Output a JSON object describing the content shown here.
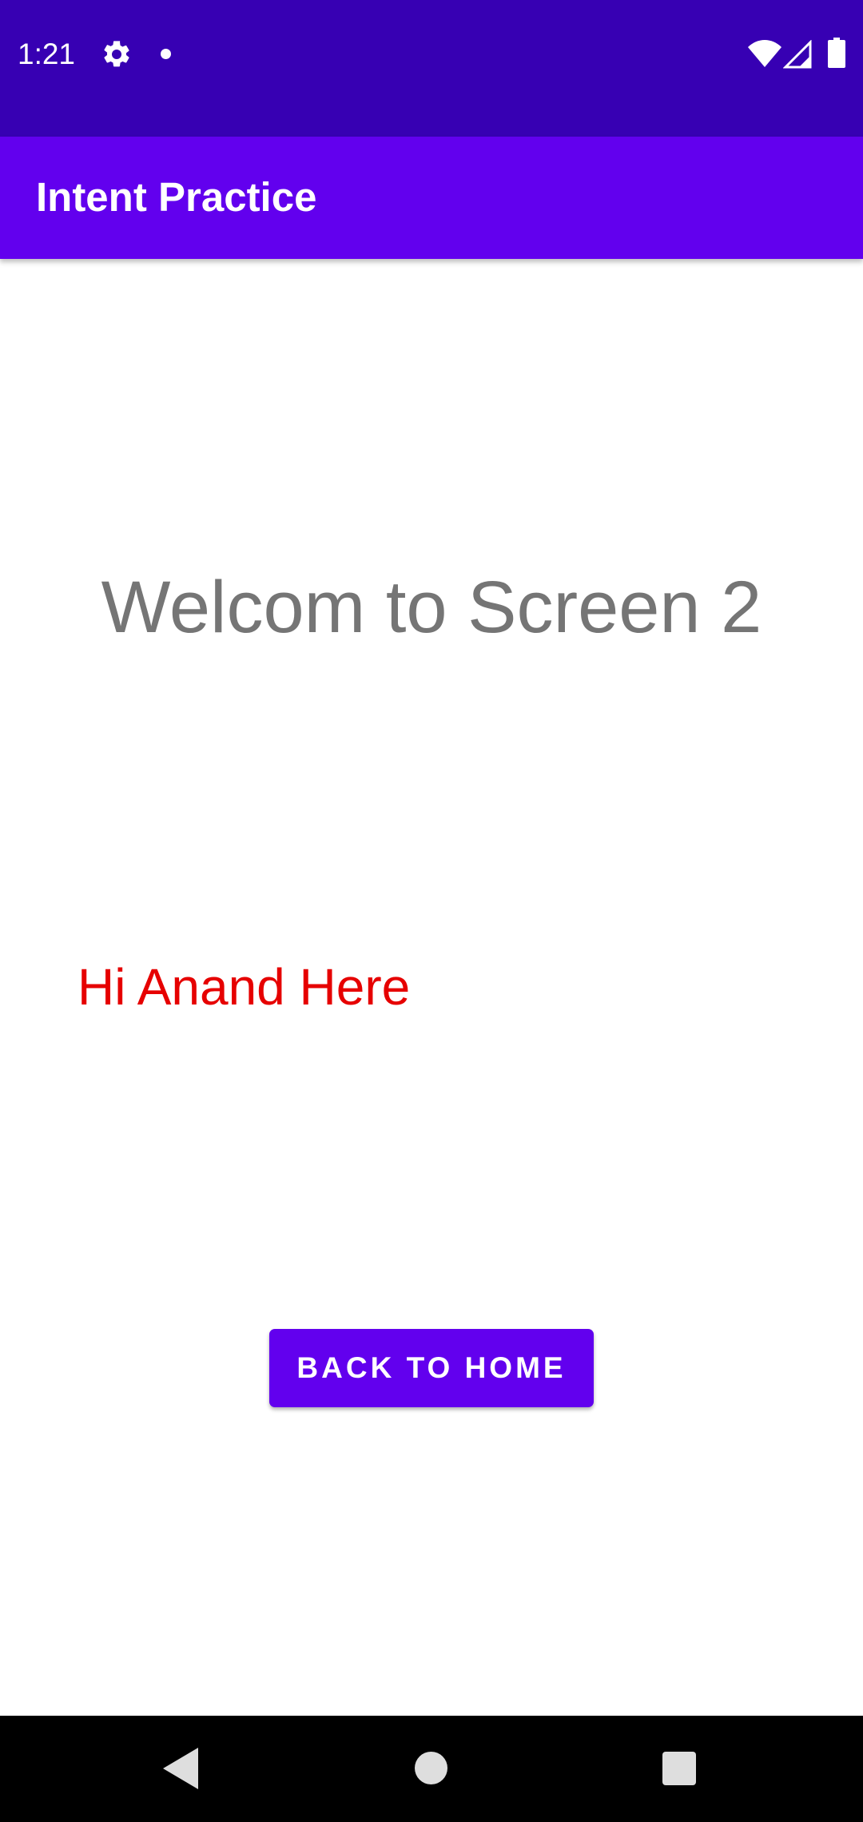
{
  "status_bar": {
    "time": "1:21",
    "icons": [
      "gear-icon",
      "notification-dot-icon",
      "wifi-icon",
      "cell-signal-icon",
      "battery-icon"
    ]
  },
  "app_bar": {
    "title": "Intent Practice"
  },
  "main": {
    "welcome_text": "Welcom to Screen 2",
    "greeting_text": "Hi Anand Here",
    "back_button_label": "BACK TO HOME"
  },
  "nav_bar": {
    "icons": [
      "back-icon",
      "home-icon",
      "recents-icon"
    ]
  },
  "colors": {
    "status_bar": "#3700b3",
    "primary": "#6200ee",
    "welcome_text": "#757575",
    "greeting_text": "#e60000"
  }
}
